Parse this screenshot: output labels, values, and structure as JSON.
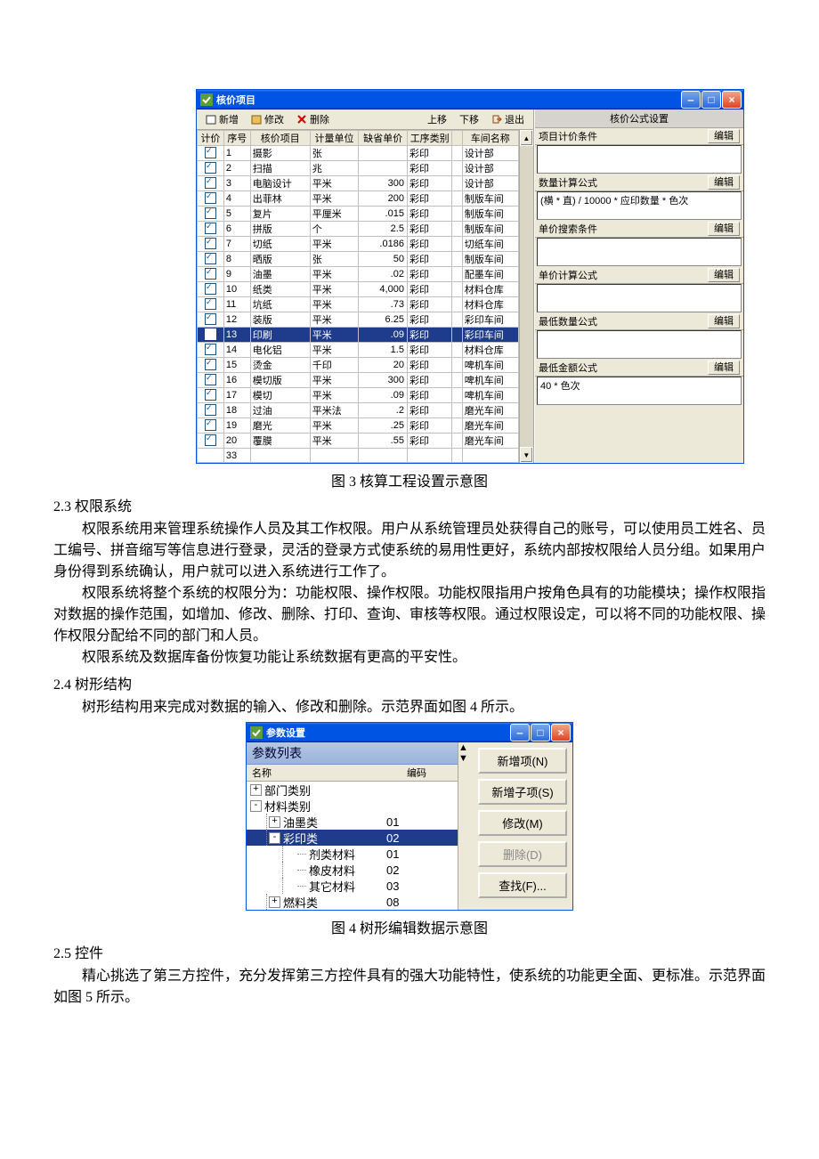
{
  "win1": {
    "title": "核价项目",
    "toolbar": {
      "add": "新增",
      "edit": "修改",
      "delete": "删除",
      "up": "上移",
      "down": "下移",
      "exit": "退出"
    },
    "columns": [
      "计价",
      "序号",
      "核价项目",
      "计量单位",
      "缺省单价",
      "工序类别",
      "",
      "车间名称"
    ],
    "rows": [
      {
        "chk": true,
        "no": "1",
        "name": "摄影",
        "unit": "张",
        "price": "",
        "proc": "彩印",
        "dept": "设计部"
      },
      {
        "chk": true,
        "no": "2",
        "name": "扫描",
        "unit": "兆",
        "price": "",
        "proc": "彩印",
        "dept": "设计部"
      },
      {
        "chk": true,
        "no": "3",
        "name": "电脑设计",
        "unit": "平米",
        "price": "300",
        "proc": "彩印",
        "dept": "设计部"
      },
      {
        "chk": true,
        "no": "4",
        "name": "出菲林",
        "unit": "平米",
        "price": "200",
        "proc": "彩印",
        "dept": "制版车间"
      },
      {
        "chk": true,
        "no": "5",
        "name": "复片",
        "unit": "平厘米",
        "price": ".015",
        "proc": "彩印",
        "dept": "制版车间"
      },
      {
        "chk": true,
        "no": "6",
        "name": "拼版",
        "unit": "个",
        "price": "2.5",
        "proc": "彩印",
        "dept": "制版车间"
      },
      {
        "chk": true,
        "no": "7",
        "name": "切纸",
        "unit": "平米",
        "price": ".0186",
        "proc": "彩印",
        "dept": "切纸车间"
      },
      {
        "chk": true,
        "no": "8",
        "name": "晒版",
        "unit": "张",
        "price": "50",
        "proc": "彩印",
        "dept": "制版车间"
      },
      {
        "chk": true,
        "no": "9",
        "name": "油墨",
        "unit": "平米",
        "price": ".02",
        "proc": "彩印",
        "dept": "配墨车间"
      },
      {
        "chk": true,
        "no": "10",
        "name": "纸类",
        "unit": "平米",
        "price": "4,000",
        "proc": "彩印",
        "dept": "材料仓库"
      },
      {
        "chk": true,
        "no": "11",
        "name": "坑纸",
        "unit": "平米",
        "price": ".73",
        "proc": "彩印",
        "dept": "材料仓库"
      },
      {
        "chk": true,
        "no": "12",
        "name": "装版",
        "unit": "平米",
        "price": "6.25",
        "proc": "彩印",
        "dept": "彩印车间"
      },
      {
        "chk": true,
        "no": "13",
        "name": "印刷",
        "unit": "平米",
        "price": ".09",
        "proc": "彩印",
        "dept": "彩印车间",
        "sel": true
      },
      {
        "chk": true,
        "no": "14",
        "name": "电化铝",
        "unit": "平米",
        "price": "1.5",
        "proc": "彩印",
        "dept": "材料仓库"
      },
      {
        "chk": true,
        "no": "15",
        "name": "烫金",
        "unit": "千印",
        "price": "20",
        "proc": "彩印",
        "dept": "啤机车间"
      },
      {
        "chk": true,
        "no": "16",
        "name": "模切版",
        "unit": "平米",
        "price": "300",
        "proc": "彩印",
        "dept": "啤机车间"
      },
      {
        "chk": true,
        "no": "17",
        "name": "模切",
        "unit": "平米",
        "price": ".09",
        "proc": "彩印",
        "dept": "啤机车间"
      },
      {
        "chk": true,
        "no": "18",
        "name": "过油",
        "unit": "平米法",
        "price": ".2",
        "proc": "彩印",
        "dept": "磨光车间"
      },
      {
        "chk": true,
        "no": "19",
        "name": "磨光",
        "unit": "平米",
        "price": ".25",
        "proc": "彩印",
        "dept": "磨光车间"
      },
      {
        "chk": true,
        "no": "20",
        "name": "覆膜",
        "unit": "平米",
        "price": ".55",
        "proc": "彩印",
        "dept": "磨光车间"
      },
      {
        "chk": false,
        "no": "33",
        "name": "",
        "unit": "",
        "price": "",
        "proc": "",
        "dept": "",
        "blank": true
      }
    ],
    "right": {
      "header": "核价公式设置",
      "edit": "编辑",
      "s1": "项目计价条件",
      "s2": "数量计算公式",
      "s2v": "(横 * 直) / 10000 * 应印数量 * 色次",
      "s3": "单价搜索条件",
      "s4": "单价计算公式",
      "s5": "最低数量公式",
      "s6": "最低金额公式",
      "s6v": "40 * 色次"
    }
  },
  "caption1": "图 3 核算工程设置示意图",
  "sec23_title": "2.3 权限系统",
  "sec23_p1": "权限系统用来管理系统操作人员及其工作权限。用户从系统管理员处获得自己的账号，可以使用员工姓名、员工编号、拼音缩写等信息进行登录，灵活的登录方式使系统的易用性更好，系统内部按权限给人员分组。如果用户身份得到系统确认，用户就可以进入系统进行工作了。",
  "sec23_p2": "权限系统将整个系统的权限分为：功能权限、操作权限。功能权限指用户按角色具有的功能模块；操作权限指对数据的操作范围，如增加、修改、删除、打印、查询、审核等权限。通过权限设定，可以将不同的功能权限、操作权限分配给不同的部门和人员。",
  "sec23_p3": "权限系统及数据库备份恢复功能让系统数据有更高的平安性。",
  "sec24_title": "2.4 树形结构",
  "sec24_p1": "树形结构用来完成对数据的输入、修改和删除。示范界面如图 4 所示。",
  "win2": {
    "title": "参数设置",
    "list_header": "参数列表",
    "col_name": "名称",
    "col_code": "编码",
    "rows": [
      {
        "indent": 0,
        "exp": "+",
        "label": "部门类别",
        "code": ""
      },
      {
        "indent": 0,
        "exp": "-",
        "label": "材料类别",
        "code": ""
      },
      {
        "indent": 1,
        "exp": "+",
        "label": "油墨类",
        "code": "01"
      },
      {
        "indent": 1,
        "exp": "-",
        "label": "彩印类",
        "code": "02",
        "sel": true
      },
      {
        "indent": 2,
        "exp": "",
        "label": "剂类材料",
        "code": "01"
      },
      {
        "indent": 2,
        "exp": "",
        "label": "橡皮材料",
        "code": "02"
      },
      {
        "indent": 2,
        "exp": "",
        "label": "其它材料",
        "code": "03"
      },
      {
        "indent": 1,
        "exp": "+",
        "label": "燃料类",
        "code": "08"
      }
    ],
    "buttons": {
      "add": "新增项(N)",
      "addchild": "新增子项(S)",
      "modify": "修改(M)",
      "delete": "删除(D)",
      "find": "查找(F)..."
    }
  },
  "caption2": "图 4 树形编辑数据示意图",
  "sec25_title": "2.5 控件",
  "sec25_p1": "精心挑选了第三方控件，充分发挥第三方控件具有的强大功能特性，使系统的功能更全面、更标准。示范界面如图 5 所示。"
}
